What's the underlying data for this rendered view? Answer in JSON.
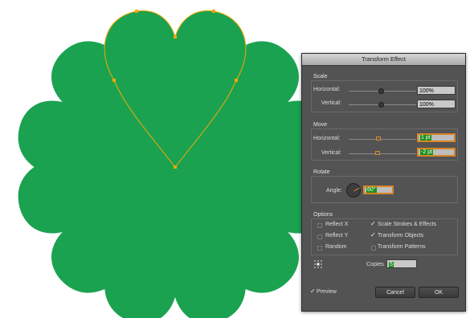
{
  "dialog": {
    "title": "Transform Effect",
    "scale": {
      "label": "Scale",
      "horizontal_label": "Horizontal:",
      "horizontal_value": "100%",
      "vertical_label": "Vertical:",
      "vertical_value": "100%"
    },
    "move": {
      "label": "Move",
      "horizontal_label": "Horizontal:",
      "horizontal_value": "1 pt",
      "vertical_label": "Vertical:",
      "vertical_value": "-2 pt"
    },
    "rotate": {
      "label": "Rotate",
      "angle_label": "Angle:",
      "angle_value": "60°"
    },
    "options": {
      "label": "Options",
      "reflect_x": {
        "label": "Reflect X",
        "checked": false
      },
      "reflect_y": {
        "label": "Reflect Y",
        "checked": false
      },
      "random": {
        "label": "Random",
        "checked": false
      },
      "scale_strokes": {
        "label": "Scale Strokes & Effects",
        "checked": true
      },
      "transform_objects": {
        "label": "Transform Objects",
        "checked": true
      },
      "transform_patterns": {
        "label": "Transform Patterns",
        "checked": false
      }
    },
    "copies_label": "Copies",
    "copies_value": "5",
    "preview": {
      "label": "Preview",
      "checked": true
    },
    "cancel_label": "Cancel",
    "ok_label": "OK"
  },
  "artwork": {
    "fill_color": "#1aa251",
    "path_color": "#f2a900",
    "copies": 5,
    "rotation_deg": 60
  }
}
